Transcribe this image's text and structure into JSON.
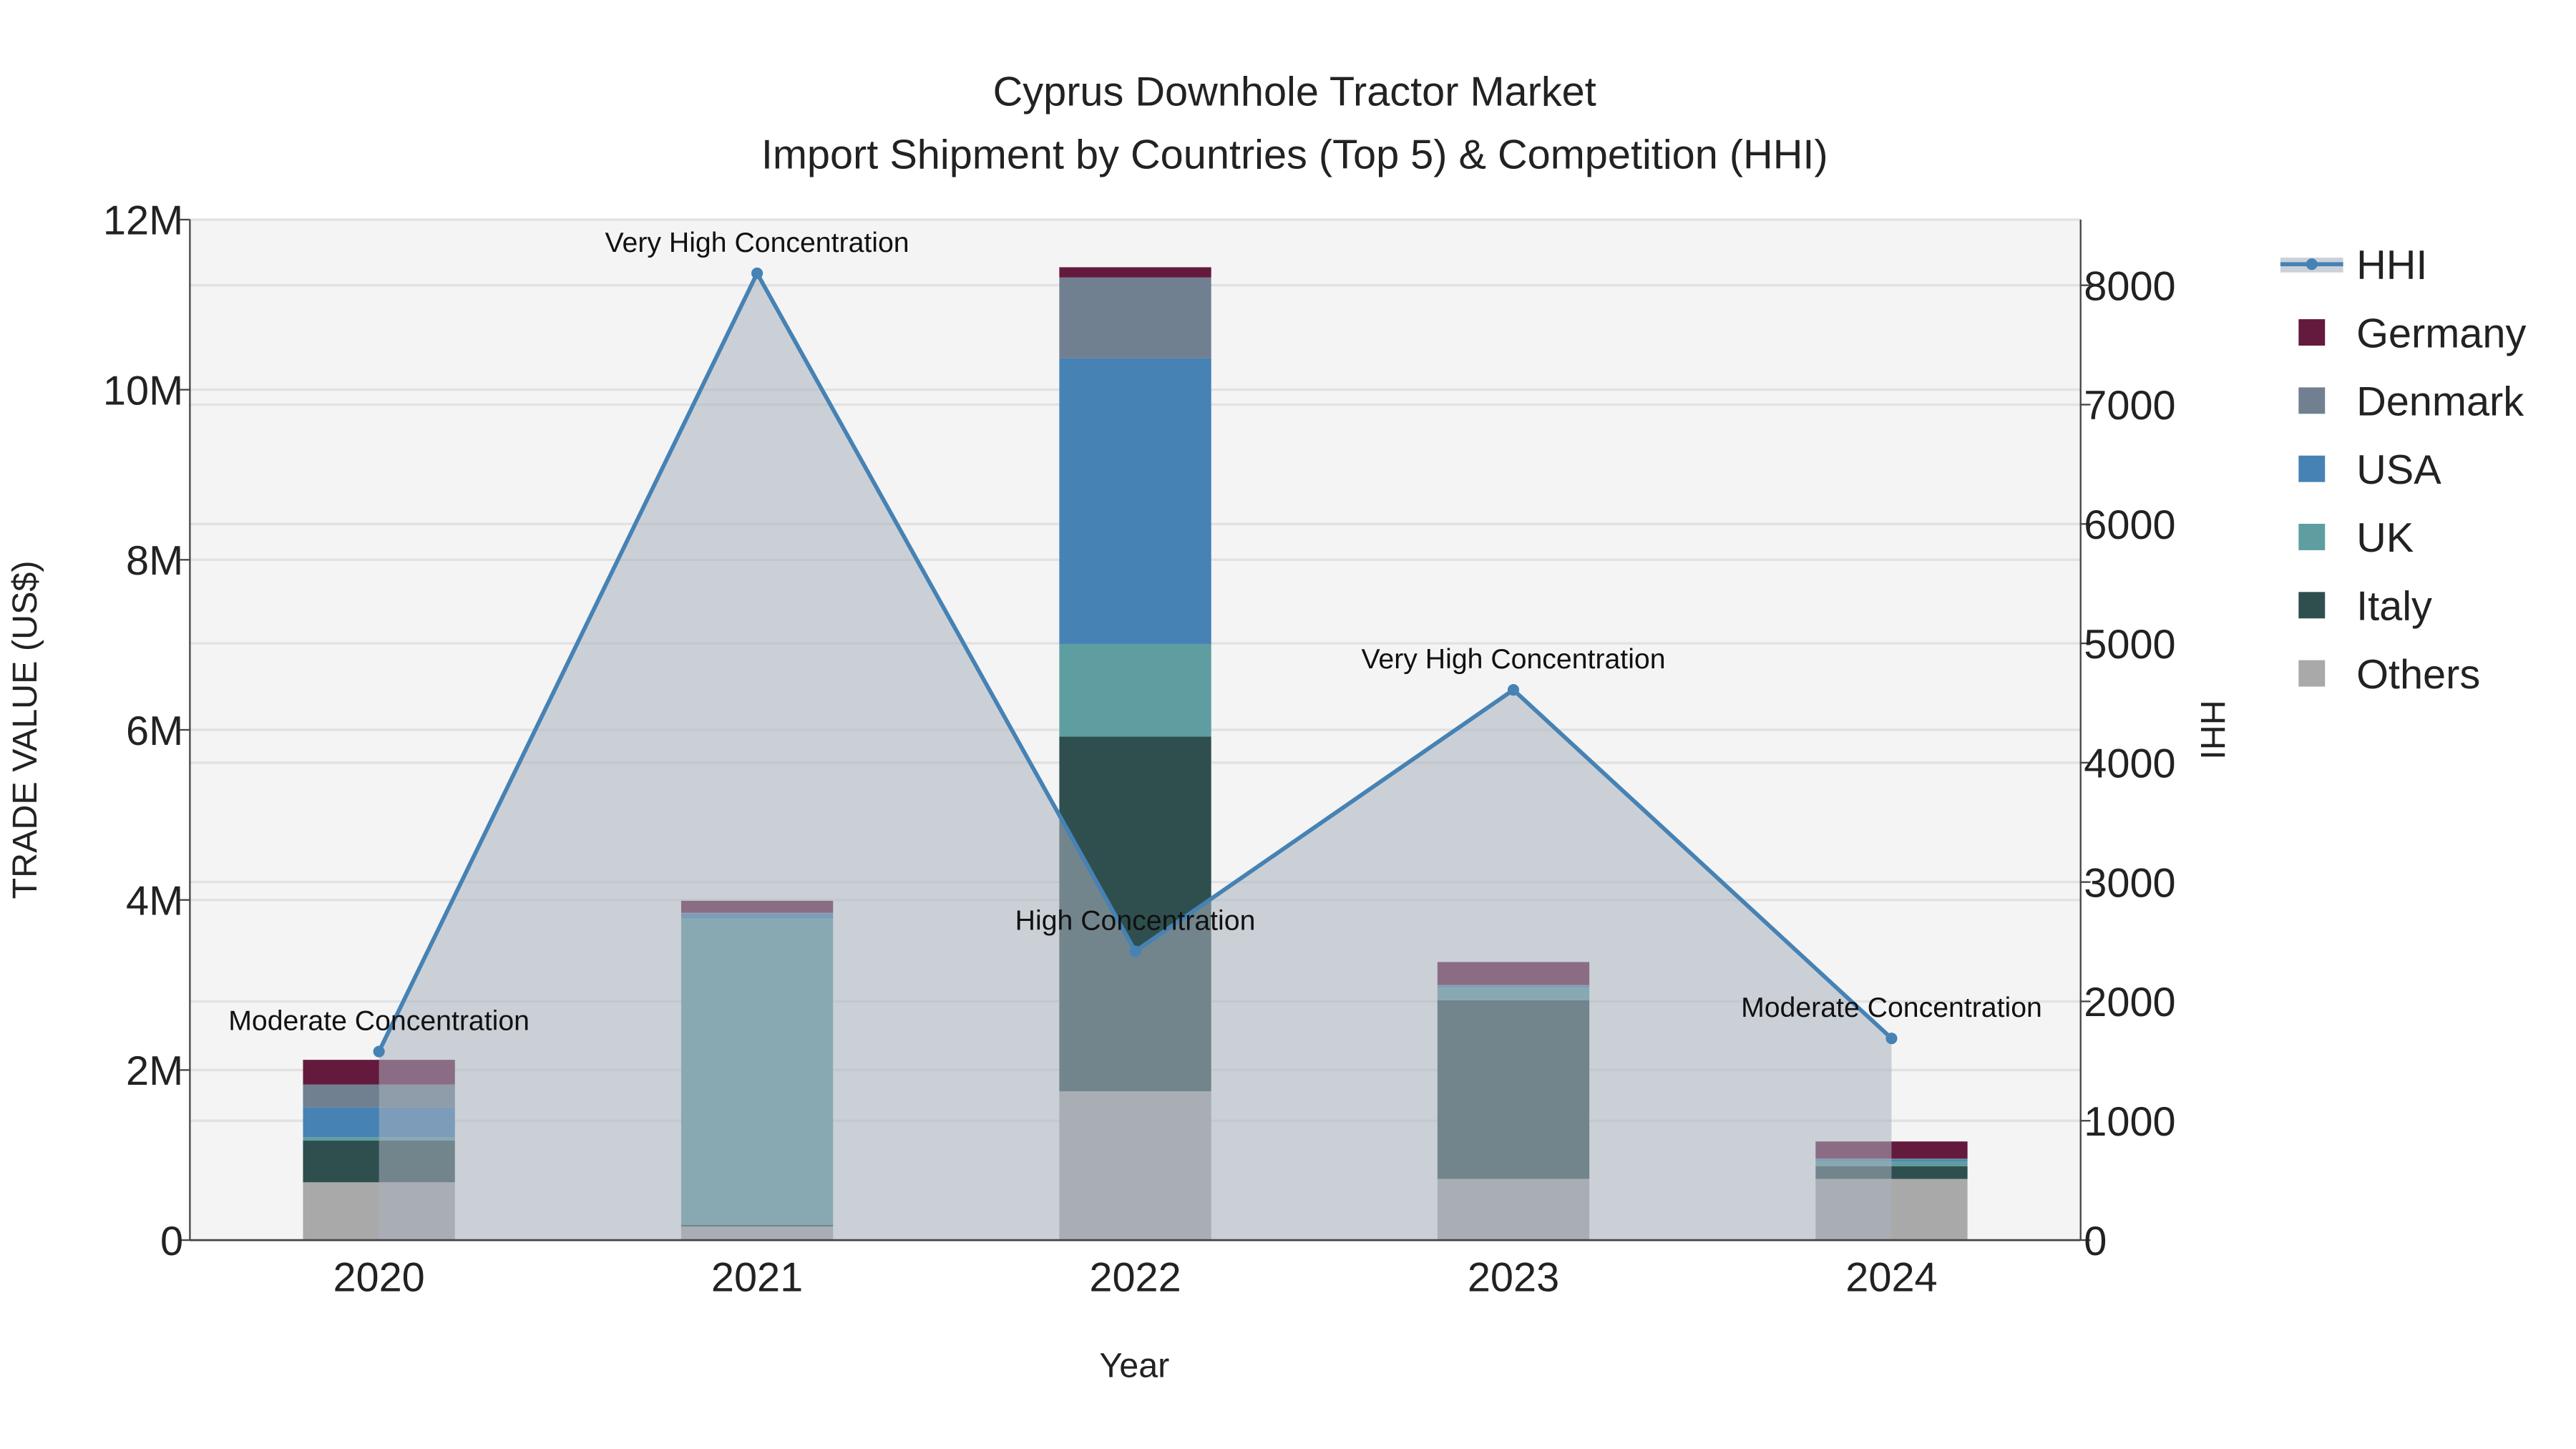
{
  "chart_data": {
    "type": "bar",
    "stacked": true,
    "title": "Cyprus Downhole Tractor Market",
    "subtitle": "Import Shipment by Countries (Top 5) & Competition (HHI)",
    "xlabel": "Year",
    "ylabel": "TRADE VALUE (US$)",
    "y2label": "HHI",
    "categories": [
      "2020",
      "2021",
      "2022",
      "2023",
      "2024"
    ],
    "ylim": [
      0,
      12000000
    ],
    "y_ticks": [
      0,
      2000000,
      4000000,
      6000000,
      8000000,
      10000000,
      12000000
    ],
    "y_tick_labels": [
      "0",
      "2M",
      "4M",
      "6M",
      "8M",
      "10M",
      "12M"
    ],
    "y2lim": [
      0,
      8550
    ],
    "y2_ticks": [
      0,
      1000,
      2000,
      3000,
      4000,
      5000,
      6000,
      7000,
      8000
    ],
    "y2_tick_labels": [
      "0",
      "1000",
      "2000",
      "3000",
      "4000",
      "5000",
      "6000",
      "7000",
      "8000"
    ],
    "grid": true,
    "legend_position": "right",
    "series": [
      {
        "name": "Others",
        "color": "#a9a9a9",
        "values": [
          680000,
          160000,
          1750000,
          720000,
          720000
        ]
      },
      {
        "name": "Italy",
        "color": "#2f4f4f",
        "values": [
          490000,
          20000,
          4170000,
          2100000,
          150000
        ]
      },
      {
        "name": "UK",
        "color": "#5f9ea0",
        "values": [
          40000,
          3600000,
          1090000,
          150000,
          60000
        ]
      },
      {
        "name": "USA",
        "color": "#4682b4",
        "values": [
          350000,
          60000,
          3360000,
          20000,
          20000
        ]
      },
      {
        "name": "Denmark",
        "color": "#708090",
        "values": [
          270000,
          10000,
          950000,
          10000,
          10000
        ]
      },
      {
        "name": "Germany",
        "color": "#641a3c",
        "values": [
          290000,
          140000,
          120000,
          270000,
          200000
        ]
      }
    ],
    "hhi": {
      "name": "HHI",
      "color": "#4682b4",
      "values": [
        1580,
        8100,
        2420,
        4610,
        1690
      ],
      "annotations": [
        "Moderate Concentration",
        "Very High Concentration",
        "High Concentration",
        "Very High Concentration",
        "Moderate Concentration"
      ]
    },
    "legend": [
      "HHI",
      "Germany",
      "Denmark",
      "USA",
      "UK",
      "Italy",
      "Others"
    ]
  }
}
